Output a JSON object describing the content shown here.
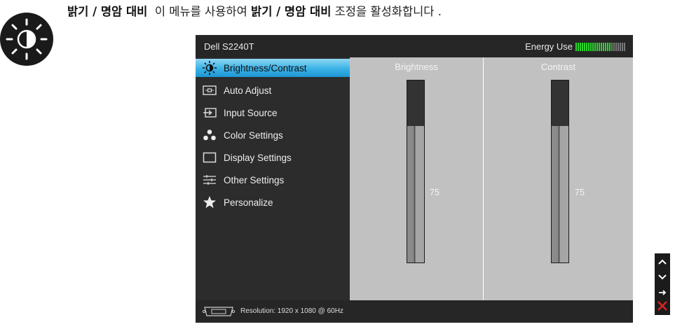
{
  "heading": {
    "title": "밝기 / 명암 대비",
    "text_before": "이 메뉴를 사용하여 ",
    "text_bold": "밝기 / 명암 대비",
    "text_after": " 조정을 활성화합니다 ."
  },
  "osd": {
    "model": "Dell S2240T",
    "energy_label": "Energy Use",
    "energy_level": 0.7,
    "menu": [
      {
        "label": "Brightness/Contrast",
        "icon": "brightness-icon",
        "active": true
      },
      {
        "label": "Auto Adjust",
        "icon": "auto-adjust-icon",
        "active": false
      },
      {
        "label": "Input Source",
        "icon": "input-source-icon",
        "active": false
      },
      {
        "label": "Color Settings",
        "icon": "color-settings-icon",
        "active": false
      },
      {
        "label": "Display Settings",
        "icon": "display-settings-icon",
        "active": false
      },
      {
        "label": "Other Settings",
        "icon": "other-settings-icon",
        "active": false
      },
      {
        "label": "Personalize",
        "icon": "star-icon",
        "active": false
      }
    ],
    "brightness": {
      "label": "Brightness",
      "value": "75",
      "level": 0.75
    },
    "contrast": {
      "label": "Contrast",
      "value": "75",
      "level": 0.75
    },
    "footer": {
      "resolution": "Resolution: 1920 x 1080 @ 60Hz",
      "icon": "vga-connector-icon"
    }
  },
  "nav": [
    "up-arrow-icon",
    "down-arrow-icon",
    "right-arrow-icon",
    "close-icon"
  ],
  "colors": {
    "accent": "#1e96d3",
    "energy": "#2fd62f",
    "close": "#e02020"
  }
}
